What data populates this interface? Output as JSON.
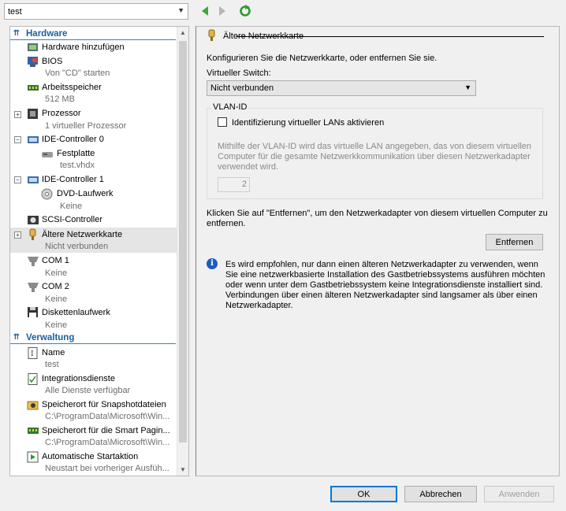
{
  "vm_selector": {
    "value": "test"
  },
  "sidebar": {
    "hardware_header": "Hardware",
    "management_header": "Verwaltung",
    "items": [
      {
        "label": "Hardware hinzufügen",
        "sub": ""
      },
      {
        "label": "BIOS",
        "sub": "Von \"CD\" starten"
      },
      {
        "label": "Arbeitsspeicher",
        "sub": "512 MB"
      },
      {
        "label": "Prozessor",
        "sub": "1 virtueller Prozessor"
      },
      {
        "label": "IDE-Controller 0",
        "sub": ""
      },
      {
        "label": "Festplatte",
        "sub": "test.vhdx"
      },
      {
        "label": "IDE-Controller 1",
        "sub": ""
      },
      {
        "label": "DVD-Laufwerk",
        "sub": "Keine"
      },
      {
        "label": "SCSI-Controller",
        "sub": ""
      },
      {
        "label": "Ältere Netzwerkkarte",
        "sub": "Nicht verbunden"
      },
      {
        "label": "COM 1",
        "sub": "Keine"
      },
      {
        "label": "COM 2",
        "sub": "Keine"
      },
      {
        "label": "Diskettenlaufwerk",
        "sub": "Keine"
      }
    ],
    "mgmt_items": [
      {
        "label": "Name",
        "sub": "test"
      },
      {
        "label": "Integrationsdienste",
        "sub": "Alle Dienste verfügbar"
      },
      {
        "label": "Speicherort für Snapshotdateien",
        "sub": "C:\\ProgramData\\Microsoft\\Win..."
      },
      {
        "label": "Speicherort für die Smart Pagin...",
        "sub": "C:\\ProgramData\\Microsoft\\Win..."
      },
      {
        "label": "Automatische Startaktion",
        "sub": "Neustart bei vorheriger Ausfüh..."
      }
    ]
  },
  "panel": {
    "title": "Ältere Netzwerkkarte",
    "intro": "Konfigurieren Sie die Netzwerkkarte, oder entfernen Sie sie.",
    "switch_label": "Virtueller Switch:",
    "switch_value": "Nicht verbunden",
    "vlan_group": "VLAN-ID",
    "vlan_checkbox": "Identifizierung virtueller LANs aktivieren",
    "vlan_help_1": "Mithilfe der VLAN-ID wird das virtuelle LAN angegeben, das von diesem virtuellen",
    "vlan_help_2": "Computer für die gesamte Netzwerkkommunikation über diesen Netzwerkadapter",
    "vlan_help_3": "verwendet wird.",
    "vlan_value": "2",
    "remove_text_1": "Klicken Sie auf \"Entfernen\", um den Netzwerkadapter von diesem virtuellen Computer zu",
    "remove_text_2": "entfernen.",
    "remove_button": "Entfernen",
    "info_1": "Es wird empfohlen, nur dann einen älteren Netzwerkadapter zu verwenden, wenn",
    "info_2": "Sie eine netzwerkbasierte Installation des Gastbetriebssystems ausführen möchten",
    "info_3": "oder wenn unter dem Gastbetriebssystem keine Integrationsdienste installiert sind.",
    "info_4": "Verbindungen über einen älteren Netzwerkadapter sind langsamer als über einen",
    "info_5": "Netzwerkadapter."
  },
  "footer": {
    "ok": "OK",
    "cancel": "Abbrechen",
    "apply": "Anwenden"
  },
  "colors": {
    "accent": "#1c5f9a",
    "nav_green": "#3aa935",
    "selection": "#e5e5e5"
  }
}
